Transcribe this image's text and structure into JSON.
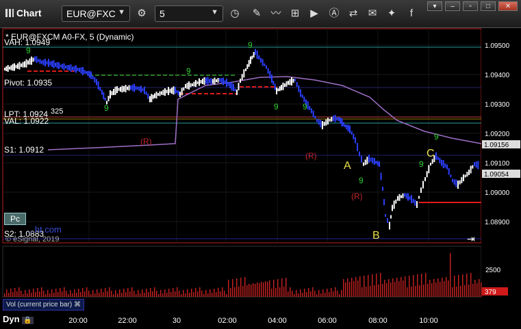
{
  "window": {
    "title": "Chart",
    "symbol": "EUR@FXC",
    "interval": "5"
  },
  "chart": {
    "header": "* EUR@FXCM A0-FX, 5 (Dynamic)",
    "watermark": "© eSignal, 2019",
    "watermark_url": "...ht.com",
    "pc_label": "Pc",
    "levels": {
      "vah": "VAH: 1.0949",
      "pivot": "Pivot: 1.0935",
      "lpt": "LPT: 1.0924",
      "lpt_extra": "325",
      "val": "VAL: 1.0922",
      "s1": "S1: 1.0912",
      "s2": "S2: 1.0883"
    },
    "price_axis": {
      "ticks": [
        "1.09500",
        "1.09400",
        "1.09300",
        "1.09200",
        "1.09100",
        "1.09000",
        "1.08900"
      ],
      "badge_vwap": "1.09156",
      "badge_last": "1.09054"
    },
    "time_axis": [
      "20:00",
      "22:00",
      "30",
      "02:00",
      "04:00",
      "06:00",
      "08:00",
      "10:00"
    ],
    "annotations": {
      "r1": "(R)",
      "r2": "(R)",
      "r3": "(R)",
      "a": "A",
      "b": "B",
      "c": "C",
      "nine": "9"
    },
    "volume": {
      "label": "Vol (current price bar)",
      "tick": "2500",
      "badge": "379"
    },
    "footer": {
      "dyn": "Dyn"
    },
    "colors": {
      "up": "#ffffff",
      "down": "#2b3fff",
      "vwap": "#a070c8",
      "pivot": "#2fa02f",
      "red_level": "#e01b1b",
      "td_count": "#2fcf2f",
      "r_label": "#c0272d",
      "abc": "#e8e04a"
    }
  }
}
